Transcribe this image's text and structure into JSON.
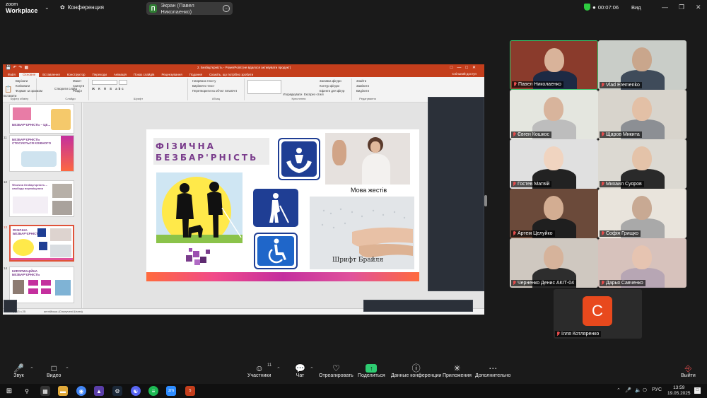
{
  "zoom": {
    "logo_line1": "zoom",
    "logo_line2": "Workplace",
    "meeting_label": "Конференция",
    "share_badge": "П",
    "share_label": "Экран (Павел Николаенко)",
    "timer": "00:07:06",
    "view_label": "Вид"
  },
  "ppt": {
    "window_title": "2. Безбар'єрність - PowerPoint (не вдалося активувати продукт)",
    "tabs": [
      "Файл",
      "Основне",
      "Вставлення",
      "Конструктор",
      "Переходи",
      "Анімація",
      "Показ слайдів",
      "Рецензування",
      "Подання"
    ],
    "active_tab": "Основне",
    "search_hint": "Скажіть, що потрібно зробити",
    "share_button": "Спільний доступ",
    "ribbon": {
      "paste": "Вставити",
      "cut": "Вирізати",
      "copy": "Копіювати",
      "format_painter": "Формат за зразком",
      "group_clipboard": "Буфер обміну",
      "new_slide": "Створити слайд",
      "layout": "Макет",
      "reset": "Скинути",
      "section": "Розділ",
      "group_slides": "Слайди",
      "group_font": "Шрифт",
      "text_direction": "Напрямок тексту",
      "align_text": "Вирівняти текст",
      "smartart": "Перетворити на об'єкт SmartArt",
      "group_paragraph": "Абзац",
      "arrange": "Упорядкувати",
      "quick_styles": "Експрес-стилі",
      "fill": "Заливка фігури",
      "outline": "Контур фігури",
      "effects": "Ефекти для фігур",
      "group_drawing": "Креслення",
      "find": "Знайти",
      "replace": "Замінити",
      "select": "Виділити",
      "group_editing": "Редагування"
    },
    "thumbnails": [
      {
        "num": "",
        "caption": "БЕЗБАР'ЄРНІСТЬ – ЦЕ..."
      },
      {
        "num": "11",
        "caption": "БЕЗБАР'ЄРНІСТЬ СТОСУЄТЬСЯ КОЖНОГО"
      },
      {
        "num": "12",
        "caption": "Фізична безбар'єрність – свобода переміщення"
      },
      {
        "num": "13",
        "caption": "ФІЗИЧНА БЕЗБАР'ЄРНІСТЬ"
      },
      {
        "num": "14",
        "caption": "ІНФОРМАЦІЙНА БЕЗБАР'ЄРНІСТЬ"
      }
    ],
    "status_slide": "Слайд 13 з 25",
    "status_lang": "англійська (Сполучені Штати)"
  },
  "slide": {
    "title_line1": "ФІЗИЧНА",
    "title_line2": "БЕЗБАР'РНІСТЬ",
    "caption_signs": "Мова жестів",
    "caption_braille": "Шрифт Брайля"
  },
  "participants": [
    {
      "name": "Павел Николаенко",
      "active": true
    },
    {
      "name": "Vlad Eremenko",
      "active": false
    },
    {
      "name": "Євген Кошкос",
      "active": false
    },
    {
      "name": "Щаров Микита",
      "active": false
    },
    {
      "name": "Гостев Матвій",
      "active": false
    },
    {
      "name": "Михаил Суяров",
      "active": false
    },
    {
      "name": "Артем Целуйко",
      "active": false
    },
    {
      "name": "Софія Грищко",
      "active": false
    },
    {
      "name": "Черненко Денис АКІТ-04",
      "active": false
    },
    {
      "name": "Дарья Савченко",
      "active": false
    },
    {
      "name": "Ілля Котляренко",
      "active": false,
      "avatar_letter": "C"
    }
  ],
  "toolbar": {
    "audio": "Звук",
    "video": "Видео",
    "participants": "Участники",
    "participants_count": "11",
    "chat": "Чат",
    "react": "Отреагировать",
    "share": "Поделиться",
    "meeting_info": "Данные конференции",
    "apps": "Приложения",
    "more": "Дополнительно",
    "leave": "Выйти"
  },
  "taskbar": {
    "lang": "РУС",
    "time": "13:59",
    "date": "19.05.2025",
    "notification_count": "5"
  },
  "colors": {
    "zoom_bg": "#1a1a1a",
    "ppt_accent": "#c43e1c",
    "slide_title": "#7a3c8c",
    "active_speaker": "#36c56b",
    "share_green": "#2ecc71",
    "avatar_orange": "#e8491d"
  }
}
